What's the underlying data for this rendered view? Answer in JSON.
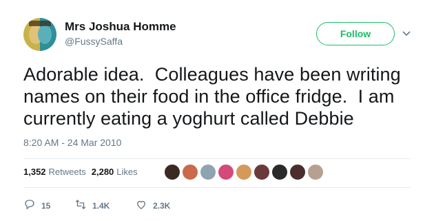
{
  "author": {
    "display_name": "Mrs Joshua Homme",
    "handle": "@FussySaffa"
  },
  "follow_button": {
    "label": "Follow"
  },
  "tweet": {
    "text": "Adorable idea.  Colleagues have been writing\nnames on their food in the office fridge.  I am\ncurrently eating a yoghurt called Debbie",
    "timestamp": "8:20 AM - 24 Mar 2010"
  },
  "stats": {
    "retweets_count": "1,352",
    "retweets_label": "Retweets",
    "likes_count": "2,280",
    "likes_label": "Likes"
  },
  "actions": {
    "replies": "15",
    "retweets": "1.4K",
    "likes": "2.3K"
  },
  "colors": {
    "follow_green": "#17bf63",
    "secondary_text": "#657786",
    "divider": "#e6ecf0"
  },
  "liker_avatars": [
    "#3a2a22",
    "#c96a4a",
    "#8fa3b1",
    "#d44a7a",
    "#d49a5a",
    "#6a3a3a",
    "#2a2a2a",
    "#4a2e2e",
    "#b8a090"
  ]
}
